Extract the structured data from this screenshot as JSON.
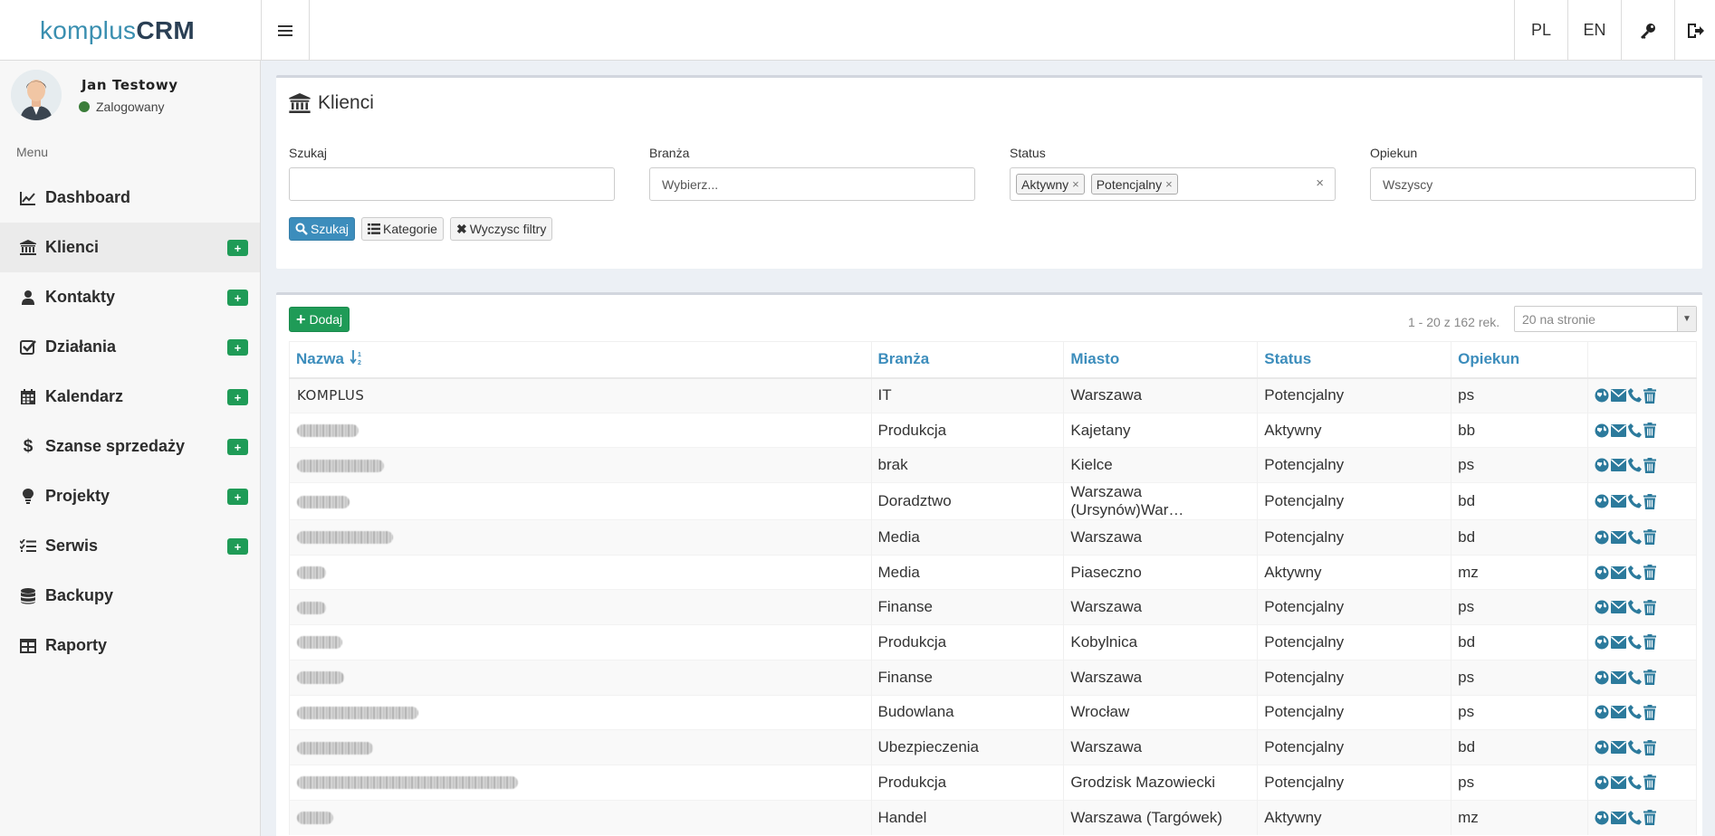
{
  "brand": {
    "prefix": "komplus",
    "bold": "CRM"
  },
  "topbar": {
    "lang_pl": "PL",
    "lang_en": "EN"
  },
  "user": {
    "name": "Jan Testowy",
    "status": "Zalogowany"
  },
  "sidebar": {
    "menu_header": "Menu",
    "items": [
      {
        "label": "Dashboard",
        "icon": "line-chart-icon",
        "plus": false
      },
      {
        "label": "Klienci",
        "icon": "bank-icon",
        "plus": true,
        "active": true
      },
      {
        "label": "Kontakty",
        "icon": "user-icon",
        "plus": true
      },
      {
        "label": "Działania",
        "icon": "check-square-icon",
        "plus": true
      },
      {
        "label": "Kalendarz",
        "icon": "calendar-icon",
        "plus": true
      },
      {
        "label": "Szanse sprzedaży",
        "icon": "dollar-icon",
        "plus": true
      },
      {
        "label": "Projekty",
        "icon": "lightbulb-icon",
        "plus": true
      },
      {
        "label": "Serwis",
        "icon": "tasks-icon",
        "plus": true
      },
      {
        "label": "Backupy",
        "icon": "database-icon",
        "plus": false
      },
      {
        "label": "Raporty",
        "icon": "table-icon",
        "plus": false
      }
    ],
    "plus_label": "+"
  },
  "filters": {
    "title": "Klienci",
    "search_label": "Szukaj",
    "search_value": "",
    "branza_label": "Branża",
    "branza_placeholder": "Wybierz...",
    "status_label": "Status",
    "status_tags": [
      "Aktywny",
      "Potencjalny"
    ],
    "opiekun_label": "Opiekun",
    "opiekun_value": "Wszyscy",
    "btn_search": "Szukaj",
    "btn_categories": "Kategorie",
    "btn_clear": "Wyczysc filtry"
  },
  "list": {
    "add_label": "Dodaj",
    "record_count": "1 - 20 z 162 rek.",
    "per_page": "20 na stronie",
    "columns": [
      "Nazwa",
      "Branża",
      "Miasto",
      "Status",
      "Opiekun"
    ],
    "rows": [
      {
        "name": "KOMPLUS",
        "branza": "IT",
        "miasto": "Warszawa",
        "status": "Potencjalny",
        "opiekun": "ps"
      },
      {
        "name": "",
        "branza": "Produkcja",
        "miasto": "Kajetany",
        "status": "Aktywny",
        "opiekun": "bb"
      },
      {
        "name": "",
        "branza": "brak",
        "miasto": "Kielce",
        "status": "Potencjalny",
        "opiekun": "ps"
      },
      {
        "name": "",
        "branza": "Doradztwo",
        "miasto": "Warszawa (Ursynów)War…",
        "status": "Potencjalny",
        "opiekun": "bd"
      },
      {
        "name": "",
        "branza": "Media",
        "miasto": "Warszawa",
        "status": "Potencjalny",
        "opiekun": "bd"
      },
      {
        "name": "",
        "branza": "Media",
        "miasto": "Piaseczno",
        "status": "Aktywny",
        "opiekun": "mz"
      },
      {
        "name": "",
        "branza": "Finanse",
        "miasto": "Warszawa",
        "status": "Potencjalny",
        "opiekun": "ps"
      },
      {
        "name": "",
        "branza": "Produkcja",
        "miasto": "Kobylnica",
        "status": "Potencjalny",
        "opiekun": "bd"
      },
      {
        "name": "",
        "branza": "Finanse",
        "miasto": "Warszawa",
        "status": "Potencjalny",
        "opiekun": "ps"
      },
      {
        "name": "",
        "branza": "Budowlana",
        "miasto": "Wrocław",
        "status": "Potencjalny",
        "opiekun": "ps"
      },
      {
        "name": "",
        "branza": "Ubezpieczenia",
        "miasto": "Warszawa",
        "status": "Potencjalny",
        "opiekun": "bd"
      },
      {
        "name": "",
        "branza": "Produkcja",
        "miasto": "Grodzisk Mazowiecki",
        "status": "Potencjalny",
        "opiekun": "ps"
      },
      {
        "name": "",
        "branza": "Handel",
        "miasto": "Warszawa (Targówek)",
        "status": "Aktywny",
        "opiekun": "mz"
      }
    ]
  },
  "colors": {
    "accent": "#3c8dbc",
    "green": "#1f9b57",
    "action_icon": "#2c7a9c"
  }
}
